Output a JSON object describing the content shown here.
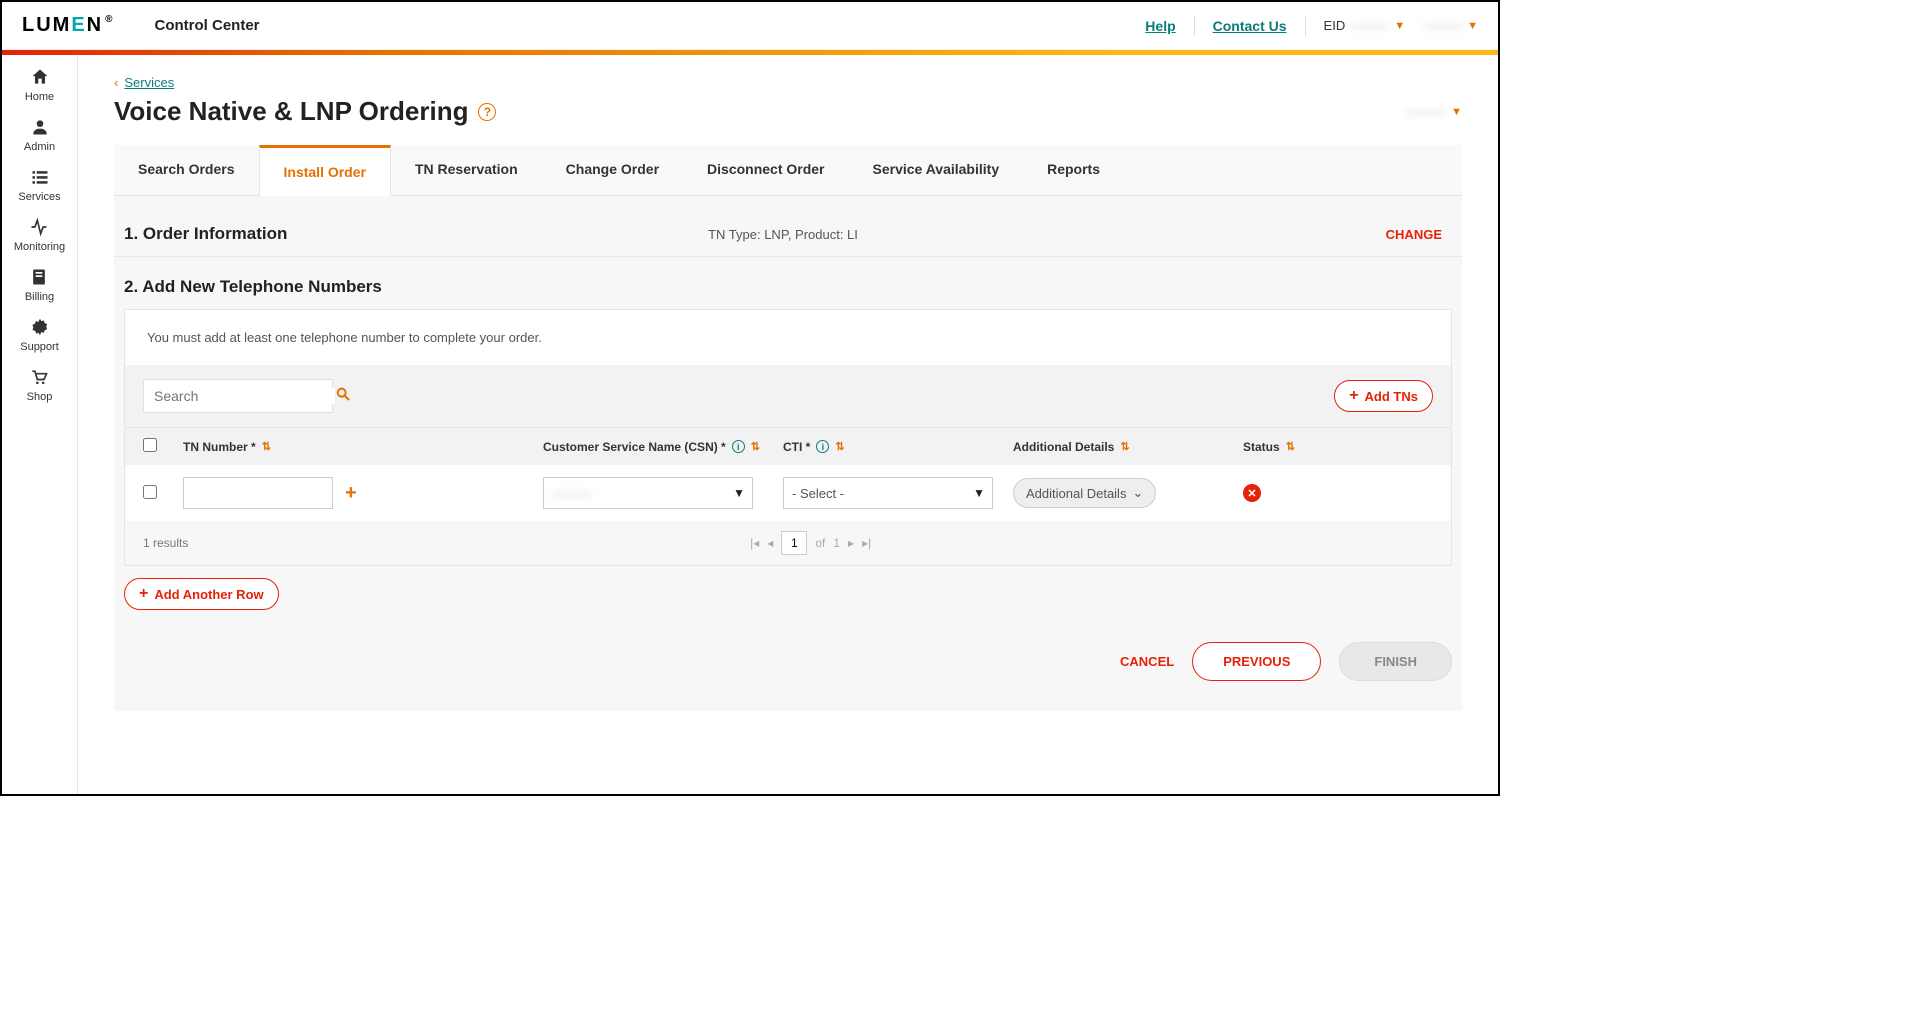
{
  "header": {
    "logo_text": "LUMEN",
    "app_name": "Control Center",
    "help": "Help",
    "contact": "Contact Us",
    "eid_label": "EID",
    "eid_value": "———",
    "user_value": "———"
  },
  "sidebar": {
    "items": [
      {
        "label": "Home"
      },
      {
        "label": "Admin"
      },
      {
        "label": "Services"
      },
      {
        "label": "Monitoring"
      },
      {
        "label": "Billing"
      },
      {
        "label": "Support"
      },
      {
        "label": "Shop"
      }
    ]
  },
  "breadcrumb": {
    "back_label": "Services"
  },
  "page": {
    "title": "Voice Native & LNP Ordering",
    "account_label": "———"
  },
  "tabs": [
    {
      "label": "Search Orders"
    },
    {
      "label": "Install Order"
    },
    {
      "label": "TN Reservation"
    },
    {
      "label": "Change Order"
    },
    {
      "label": "Disconnect Order"
    },
    {
      "label": "Service Availability"
    },
    {
      "label": "Reports"
    }
  ],
  "section1": {
    "title": "1. Order Information",
    "info": "TN Type: LNP, Product: LI",
    "change": "CHANGE"
  },
  "section2": {
    "title": "2. Add New Telephone Numbers",
    "message": "You must add at least one telephone number to complete your order.",
    "search_placeholder": "Search",
    "add_tns": "Add TNs",
    "columns": {
      "tn": "TN Number *",
      "csn": "Customer Service Name (CSN) *",
      "cti": "CTI *",
      "additional": "Additional Details",
      "status": "Status"
    },
    "row": {
      "tn_value": "",
      "csn_value": "———",
      "cti_value": "- Select -",
      "additional_label": "Additional Details"
    },
    "results_text": "1 results",
    "pager": {
      "page": "1",
      "of_label": "of",
      "total": "1"
    },
    "add_another": "Add Another Row"
  },
  "actions": {
    "cancel": "CANCEL",
    "previous": "PREVIOUS",
    "finish": "FINISH"
  }
}
